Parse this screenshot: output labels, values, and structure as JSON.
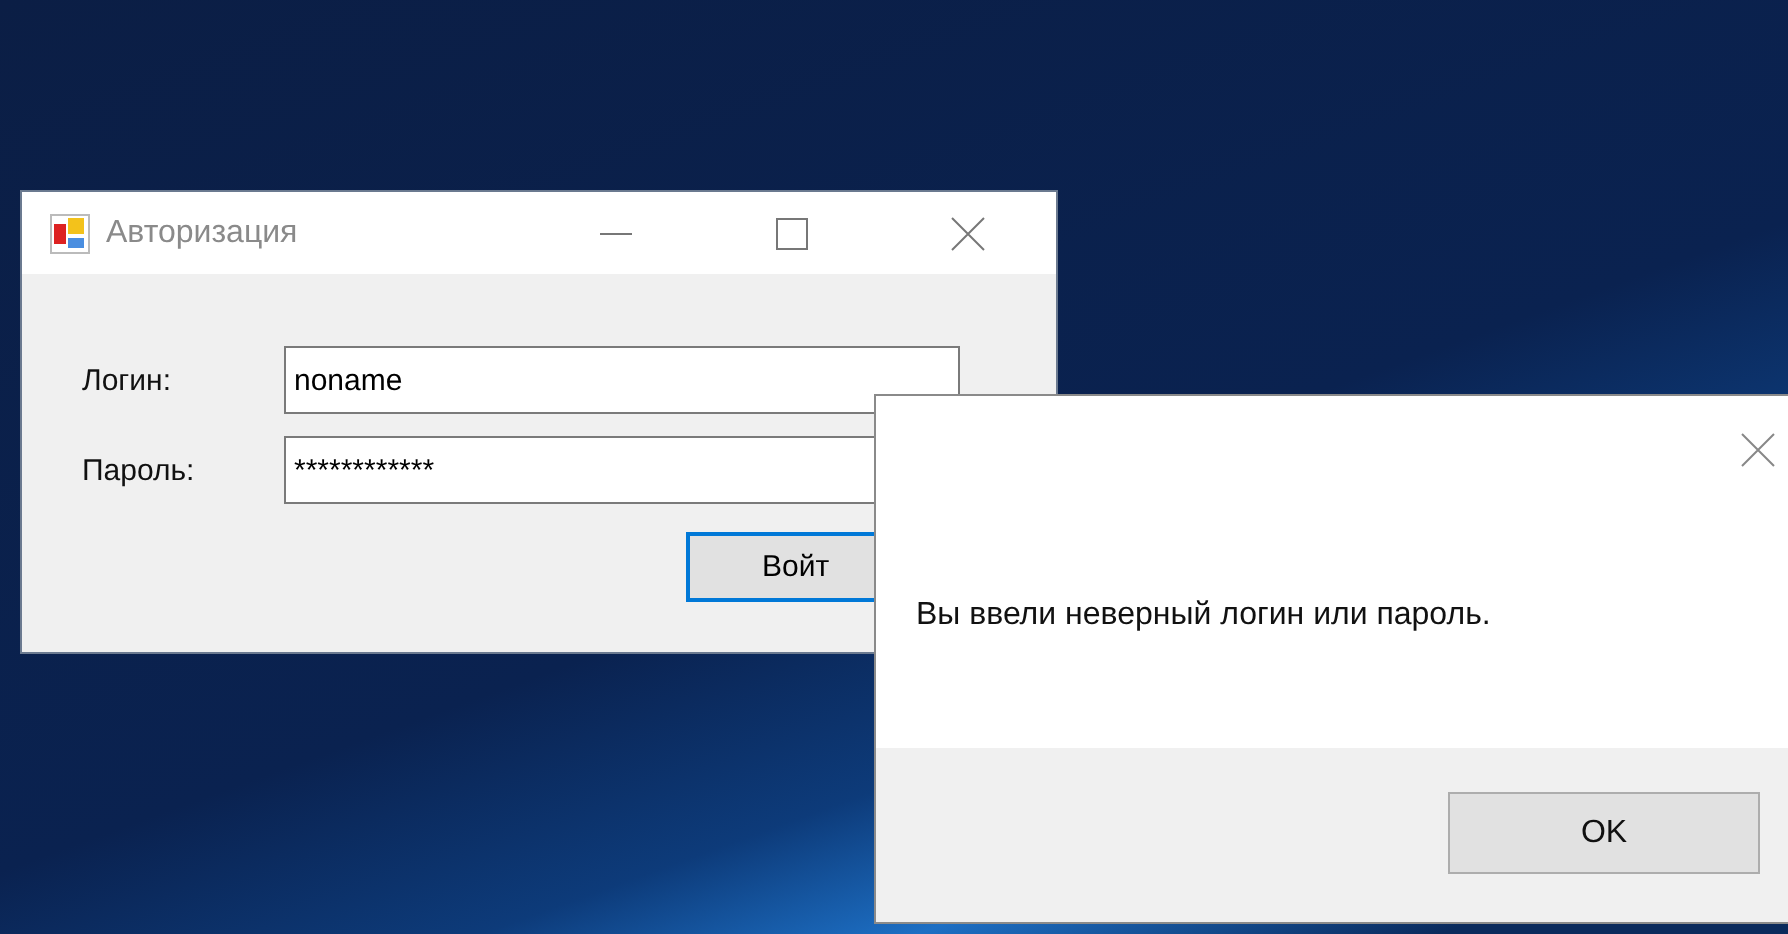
{
  "login_window": {
    "title": "Авторизация",
    "fields": [
      {
        "label": "Логин:",
        "value": "noname"
      },
      {
        "label": "Пароль:",
        "value": "************"
      }
    ],
    "submit_button": {
      "label": "Войт",
      "focused": true
    }
  },
  "message_box": {
    "message": "Вы ввели неверный логин или пароль.",
    "button": "OK"
  }
}
